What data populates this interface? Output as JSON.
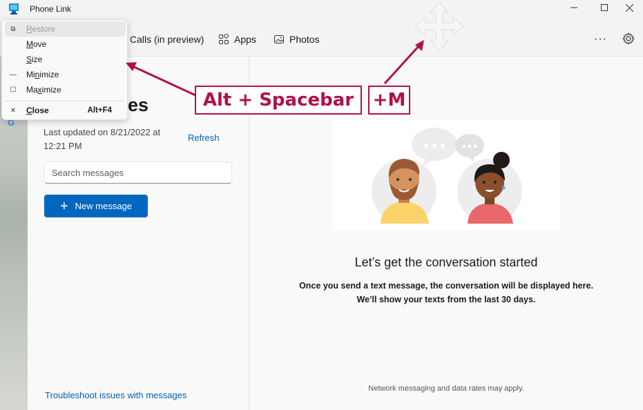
{
  "window": {
    "title": "Phone Link",
    "controls": {
      "minimize": "—",
      "maximize": "☐",
      "close": "✕"
    }
  },
  "nav": {
    "items": [
      {
        "label": "Calls (in preview)",
        "icon": "phone-icon"
      },
      {
        "label": "Apps",
        "icon": "apps-grid-icon"
      },
      {
        "label": "Photos",
        "icon": "photos-icon"
      }
    ],
    "more_label": "···",
    "settings_icon": "gear-icon"
  },
  "system_menu": {
    "items": [
      {
        "icon": "restore-icon",
        "icon_glyph": "⧉",
        "label": "Restore",
        "shortcut": "",
        "disabled": true
      },
      {
        "icon": "",
        "icon_glyph": "",
        "label": "Move",
        "shortcut": "",
        "disabled": false
      },
      {
        "icon": "",
        "icon_glyph": "",
        "label": "Size",
        "shortcut": "",
        "disabled": false
      },
      {
        "icon": "minimize-icon",
        "icon_glyph": "—",
        "label": "Minimize",
        "shortcut": "",
        "disabled": false
      },
      {
        "icon": "maximize-icon",
        "icon_glyph": "☐",
        "label": "Maximize",
        "shortcut": "",
        "disabled": false
      },
      {
        "icon": "close-icon",
        "icon_glyph": "✕",
        "label": "Close",
        "shortcut": "Alt+F4",
        "disabled": false
      }
    ]
  },
  "messages_panel": {
    "title_visible": "es",
    "last_updated": "Last updated on 8/21/2022 at 12:21 PM",
    "refresh_label": "Refresh",
    "search_placeholder": "Search messages",
    "new_message_label": "New message",
    "troubleshoot_label": "Troubleshoot issues with messages"
  },
  "conversation": {
    "title": "Let’s get the conversation started",
    "body_line1": "Once you send a text message, the conversation will be displayed here.",
    "body_line2": "We’ll show your texts from the last 30 days.",
    "disclaimer": "Network messaging and data rates may apply."
  },
  "annotations": {
    "hotkey": "Alt + Spacebar",
    "move_key": "+M",
    "color": "#b01048"
  },
  "colors": {
    "accent": "#0067c0",
    "link": "#005fb8"
  }
}
